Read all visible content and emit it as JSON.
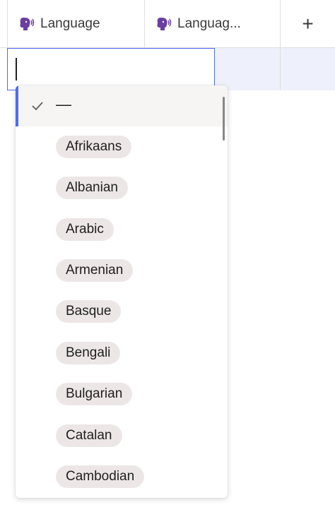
{
  "table": {
    "columns": [
      {
        "label": "Language"
      },
      {
        "label": "Languag..."
      }
    ],
    "add_column_label": "+"
  },
  "cell_editor": {
    "value": "",
    "placeholder": ""
  },
  "dropdown": {
    "selected_option": "—",
    "options": [
      "Afrikaans",
      "Albanian",
      "Arabic",
      "Armenian",
      "Basque",
      "Bengali",
      "Bulgarian",
      "Catalan",
      "Cambodian"
    ]
  },
  "colors": {
    "accent": "#4f6bed",
    "pill_background": "#ece7e6",
    "column_icon": "#6b3fa0",
    "row_highlight": "#eef0fb"
  },
  "icons": {
    "column_icon": "speaking-head-icon",
    "check": "checkmark-icon",
    "add": "plus-icon"
  }
}
